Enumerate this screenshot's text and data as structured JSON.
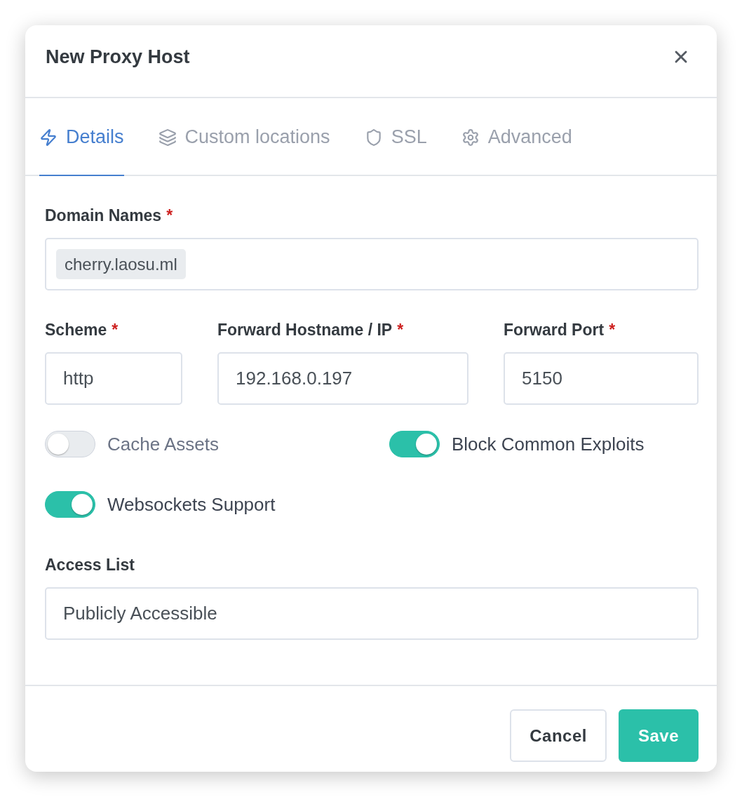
{
  "dialog": {
    "title": "New Proxy Host"
  },
  "tabs": [
    {
      "label": "Details",
      "selected": true
    },
    {
      "label": "Custom locations",
      "selected": false
    },
    {
      "label": "SSL",
      "selected": false
    },
    {
      "label": "Advanced",
      "selected": false
    }
  ],
  "domain_names": {
    "label": "Domain Names",
    "required_mark": "*",
    "tags": [
      "cherry.laosu.ml"
    ]
  },
  "forward": [
    {
      "label": "Scheme",
      "required_mark": "*",
      "value": "http"
    },
    {
      "label": "Forward Hostname / IP",
      "required_mark": "*",
      "value": "192.168.0.197"
    },
    {
      "label": "Forward Port",
      "required_mark": "*",
      "value": "5150"
    }
  ],
  "toggles": [
    {
      "label": "Cache Assets",
      "on": false
    },
    {
      "label": "Block Common Exploits",
      "on": true
    },
    {
      "label": "Websockets Support",
      "on": true
    }
  ],
  "access_list": {
    "label": "Access List",
    "value": "Publicly Accessible"
  },
  "buttons": [
    {
      "label": "Cancel",
      "kind": "secondary"
    },
    {
      "label": "Save",
      "kind": "primary"
    }
  ]
}
